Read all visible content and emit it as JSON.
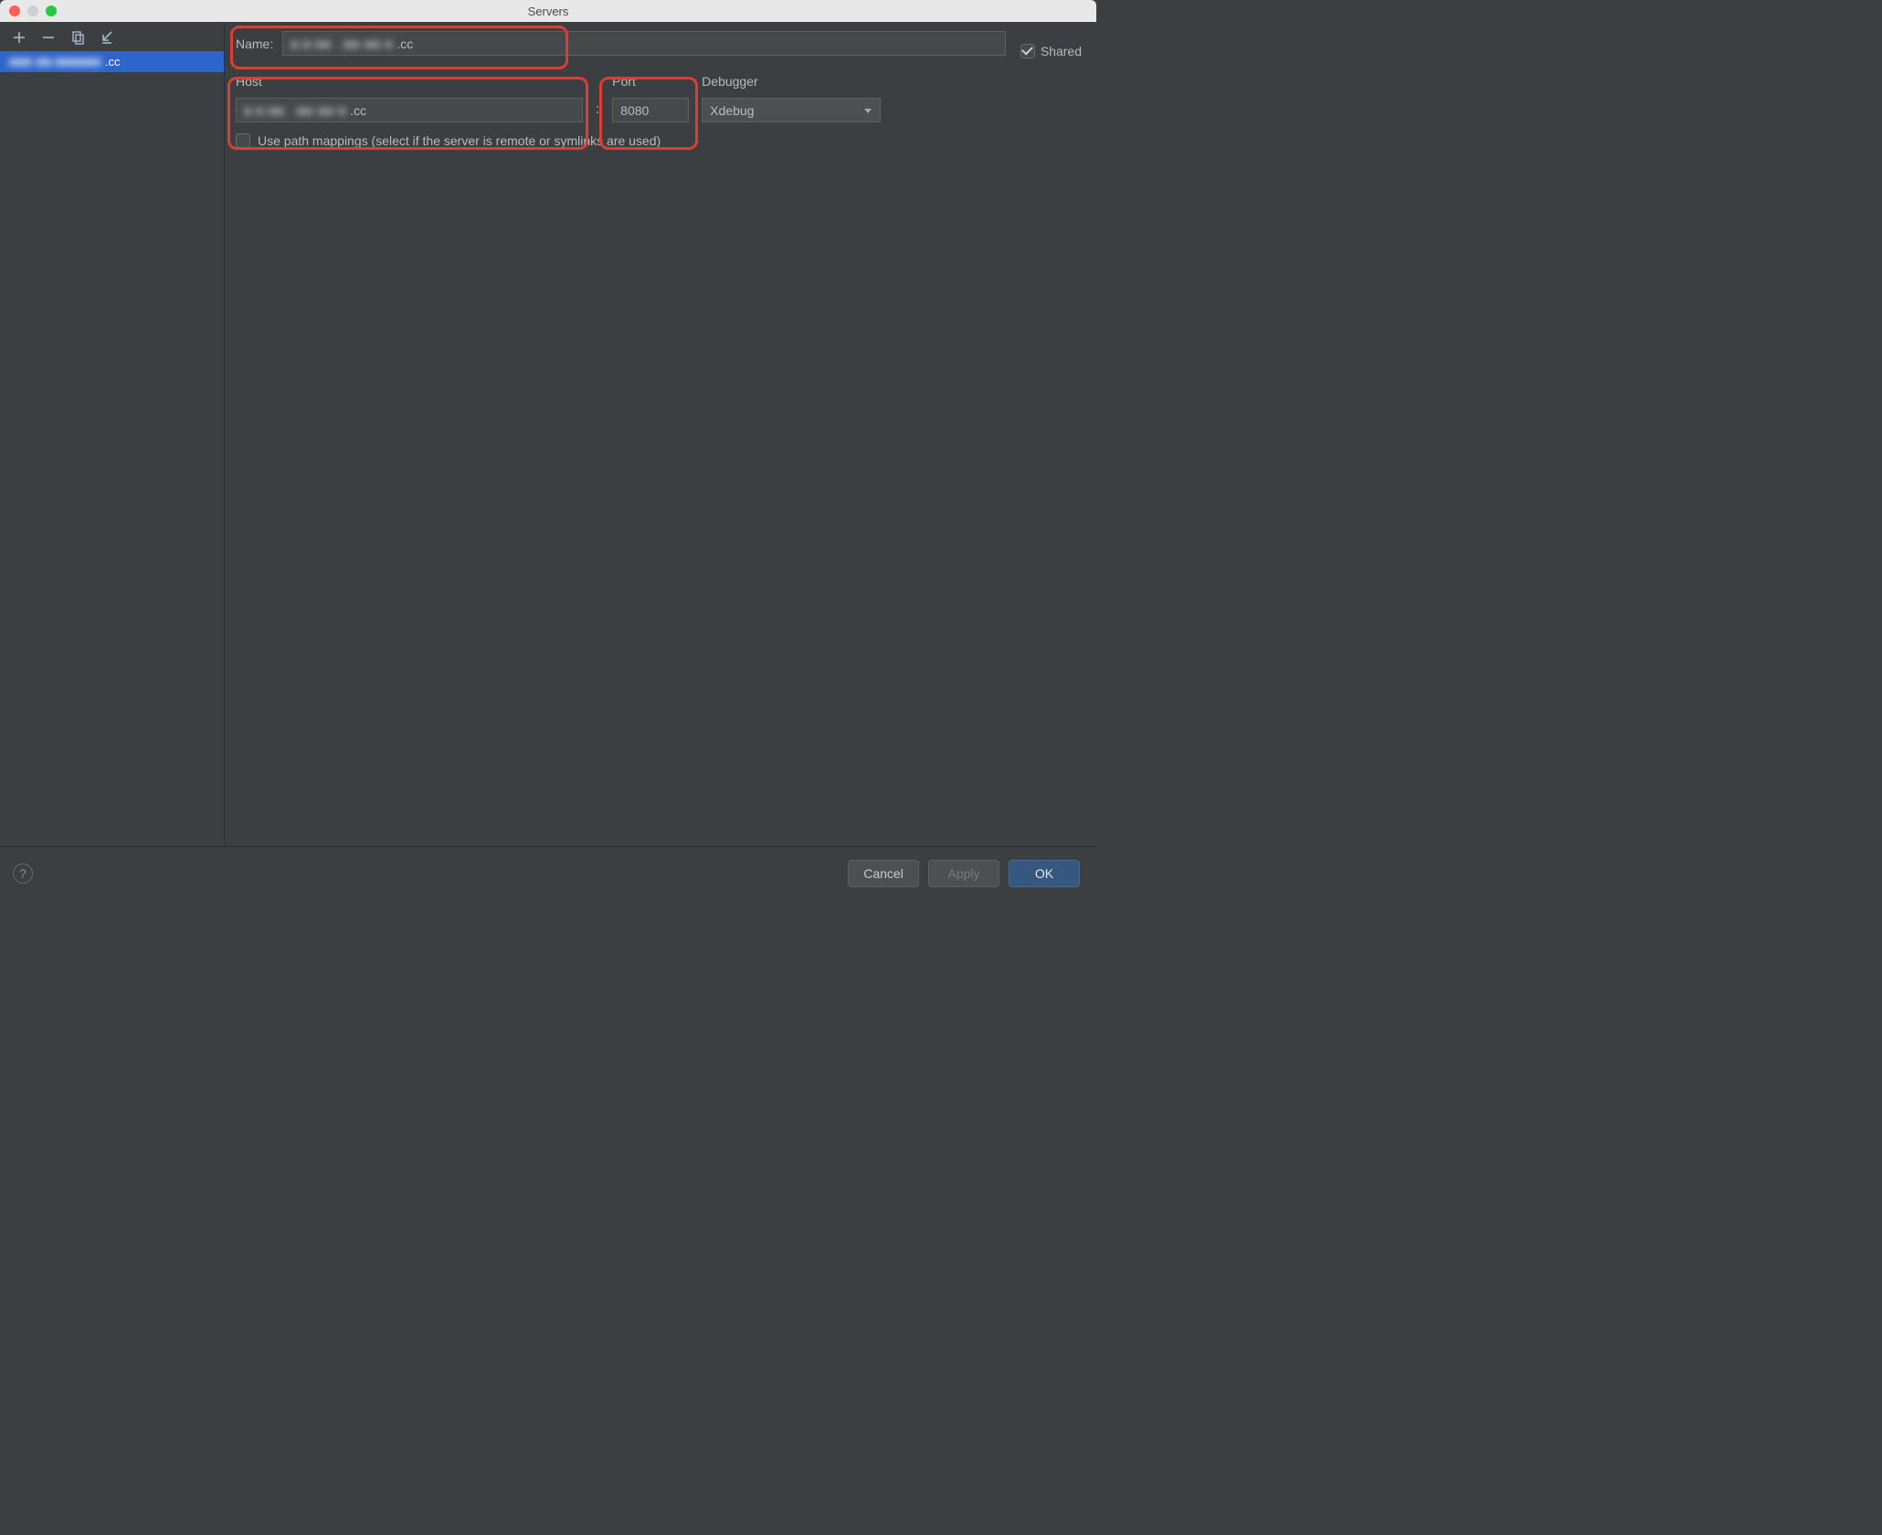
{
  "window_title": "Servers",
  "sidebar": {
    "items": [
      {
        "label_blur": "■■■·■■:■■■■■■",
        "label_suffix": ".cc"
      }
    ]
  },
  "form": {
    "name_label": "Name:",
    "name_value_blur": "■.■  ■■ . ■■·■■  ■",
    "name_value_suffix": ".cc",
    "host_label": "Host",
    "host_value_blur": "■.■  ■■ . ■■·■■  ■",
    "host_value_suffix": ".cc",
    "port_label": "Port",
    "port_value": "8080",
    "debugger_label": "Debugger",
    "debugger_value": "Xdebug",
    "shared_label": "Shared",
    "shared_checked": true,
    "pathmap_label": "Use path mappings (select if the server is remote or symlinks are used)",
    "pathmap_checked": false
  },
  "buttons": {
    "cancel": "Cancel",
    "apply": "Apply",
    "ok": "OK"
  }
}
